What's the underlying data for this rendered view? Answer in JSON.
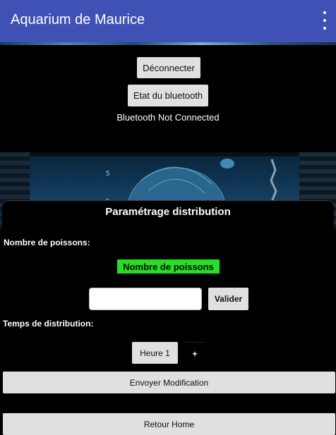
{
  "app": {
    "title": "Aquarium de Maurice"
  },
  "connection": {
    "disconnect_label": "Déconnecter",
    "state_label": "Etat du bluetooth",
    "status_text": "Bluetooth Not Connected"
  },
  "settings": {
    "title": "Paramétrage distribution",
    "fish_count_label": "Nombre de poissons:",
    "fish_count_badge": "Nombre de poissons",
    "fish_count_input": {
      "value": "",
      "placeholder": ""
    },
    "validate_label": "Valider",
    "time_label": "Temps de distribution:",
    "hour_tab_label": "Heure 1",
    "add_tab_label": "+",
    "send_label": "Envoyer Modification",
    "home_label": "Retour Home"
  },
  "colors": {
    "appbar": "#3f51b5",
    "badge": "#22e11f",
    "button": "#e0e0e0",
    "background": "#000000"
  }
}
